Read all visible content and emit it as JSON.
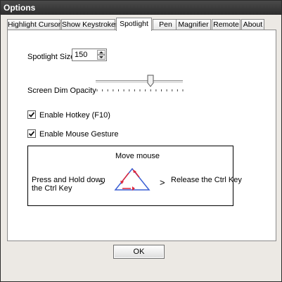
{
  "window": {
    "title": "Options"
  },
  "tabs": [
    {
      "label": "Highlight Cursor"
    },
    {
      "label": "Show Keystrokes"
    },
    {
      "label": "Spotlight"
    },
    {
      "label": "Pen"
    },
    {
      "label": "Magnifier"
    },
    {
      "label": "Remote"
    },
    {
      "label": "About"
    }
  ],
  "active_tab": "Spotlight",
  "spotlight": {
    "size_label": "Spotlight Size",
    "size_value": "150",
    "dim_label": "Screen Dim Opacity",
    "dim_level_fraction": 0.62,
    "hotkey_label": "Enable Hotkey (F10)",
    "hotkey_checked": true,
    "gesture_label": "Enable Mouse Gesture",
    "gesture_checked": true
  },
  "gesture_diagram": {
    "top_text": "Move mouse",
    "left_text_line1": "Press and Hold down",
    "left_text_line2": "the Ctrl Key",
    "arrow1": ">",
    "arrow2": ">",
    "right_text": "Release the Ctrl Key",
    "triangle_color": "#3a5fd4",
    "arrow_color": "#e0253a"
  },
  "footer": {
    "ok_label": "OK"
  }
}
